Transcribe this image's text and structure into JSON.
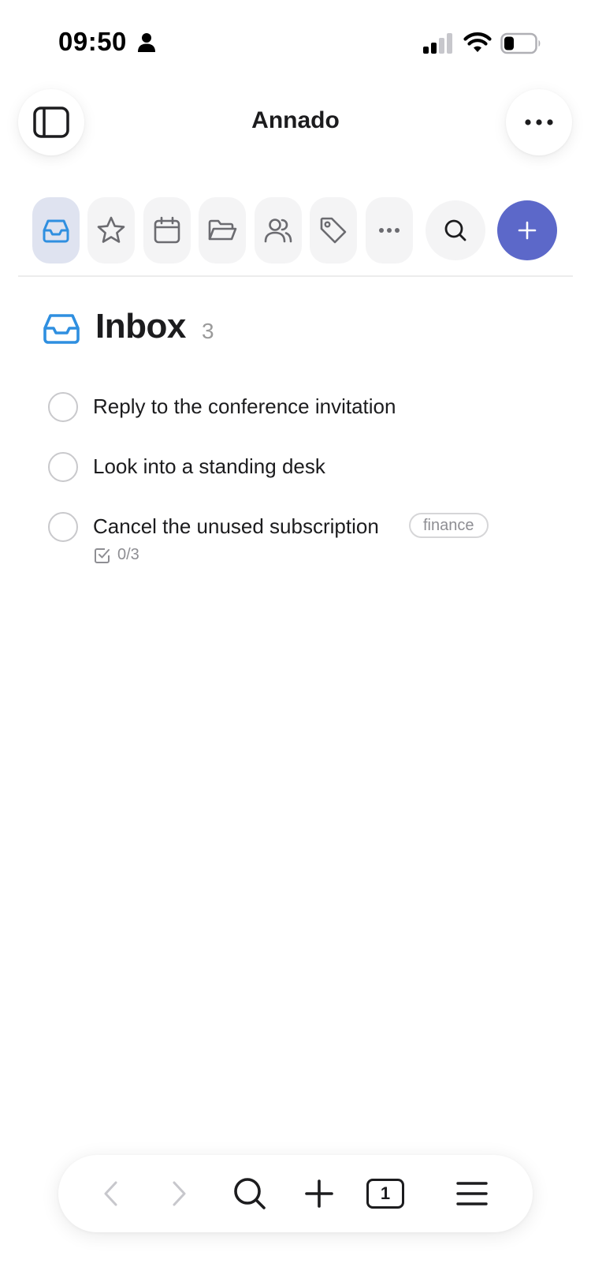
{
  "status_bar": {
    "time": "09:50",
    "icons": [
      "person-icon",
      "cellular-signal-icon",
      "wifi-icon",
      "battery-icon"
    ]
  },
  "header": {
    "title": "Annado",
    "left_button_icon": "sidebar-toggle-icon",
    "right_button_icon": "ellipsis-icon"
  },
  "toolbar": {
    "items": [
      {
        "icon": "inbox-icon",
        "active": true
      },
      {
        "icon": "star-icon",
        "active": false
      },
      {
        "icon": "calendar-icon",
        "active": false
      },
      {
        "icon": "folder-icon",
        "active": false
      },
      {
        "icon": "people-icon",
        "active": false
      },
      {
        "icon": "tag-icon",
        "active": false
      },
      {
        "icon": "ellipsis-icon",
        "active": false
      }
    ],
    "search_icon": "search-icon",
    "add_icon": "plus-icon"
  },
  "inbox": {
    "title": "Inbox",
    "count": "3",
    "tasks": [
      {
        "title": "Reply to the conference invitation"
      },
      {
        "title": "Look into a standing desk"
      },
      {
        "title": "Cancel the unused subscription",
        "tag": "finance",
        "subtasks": "0/3"
      }
    ]
  },
  "bottom_bar": {
    "tab_count": "1",
    "icons": [
      "back-icon",
      "forward-icon",
      "search-icon",
      "plus-icon",
      "tabs-icon",
      "menu-icon"
    ]
  },
  "colors": {
    "accent": "#5c68c9",
    "inbox_blue": "#2f8fe0",
    "active_tool_bg": "#dfe3f0"
  }
}
